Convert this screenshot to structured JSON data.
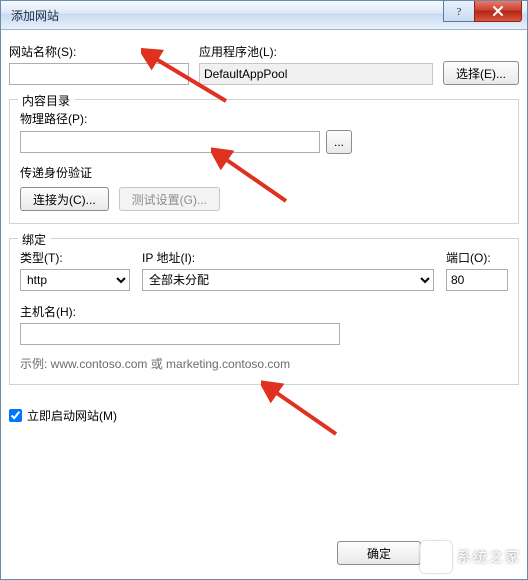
{
  "window": {
    "title": "添加网站"
  },
  "site_name": {
    "label": "网站名称(S):",
    "value": ""
  },
  "app_pool": {
    "label": "应用程序池(L):",
    "value": "DefaultAppPool",
    "select_btn": "选择(E)..."
  },
  "content_dir": {
    "legend": "内容目录",
    "path_label": "物理路径(P):",
    "path_value": "",
    "browse_btn": "...",
    "auth_label": "传递身份验证",
    "connect_as_btn": "连接为(C)...",
    "test_btn": "测试设置(G)..."
  },
  "binding": {
    "legend": "绑定",
    "type_label": "类型(T):",
    "type_value": "http",
    "ip_label": "IP 地址(I):",
    "ip_value": "全部未分配",
    "port_label": "端口(O):",
    "port_value": "80",
    "host_label": "主机名(H):",
    "host_value": "",
    "example": "示例: www.contoso.com 或 marketing.contoso.com"
  },
  "start_now": {
    "label": "立即启动网站(M)",
    "checked": true
  },
  "buttons": {
    "ok": "确定"
  },
  "watermark": "系统之家"
}
